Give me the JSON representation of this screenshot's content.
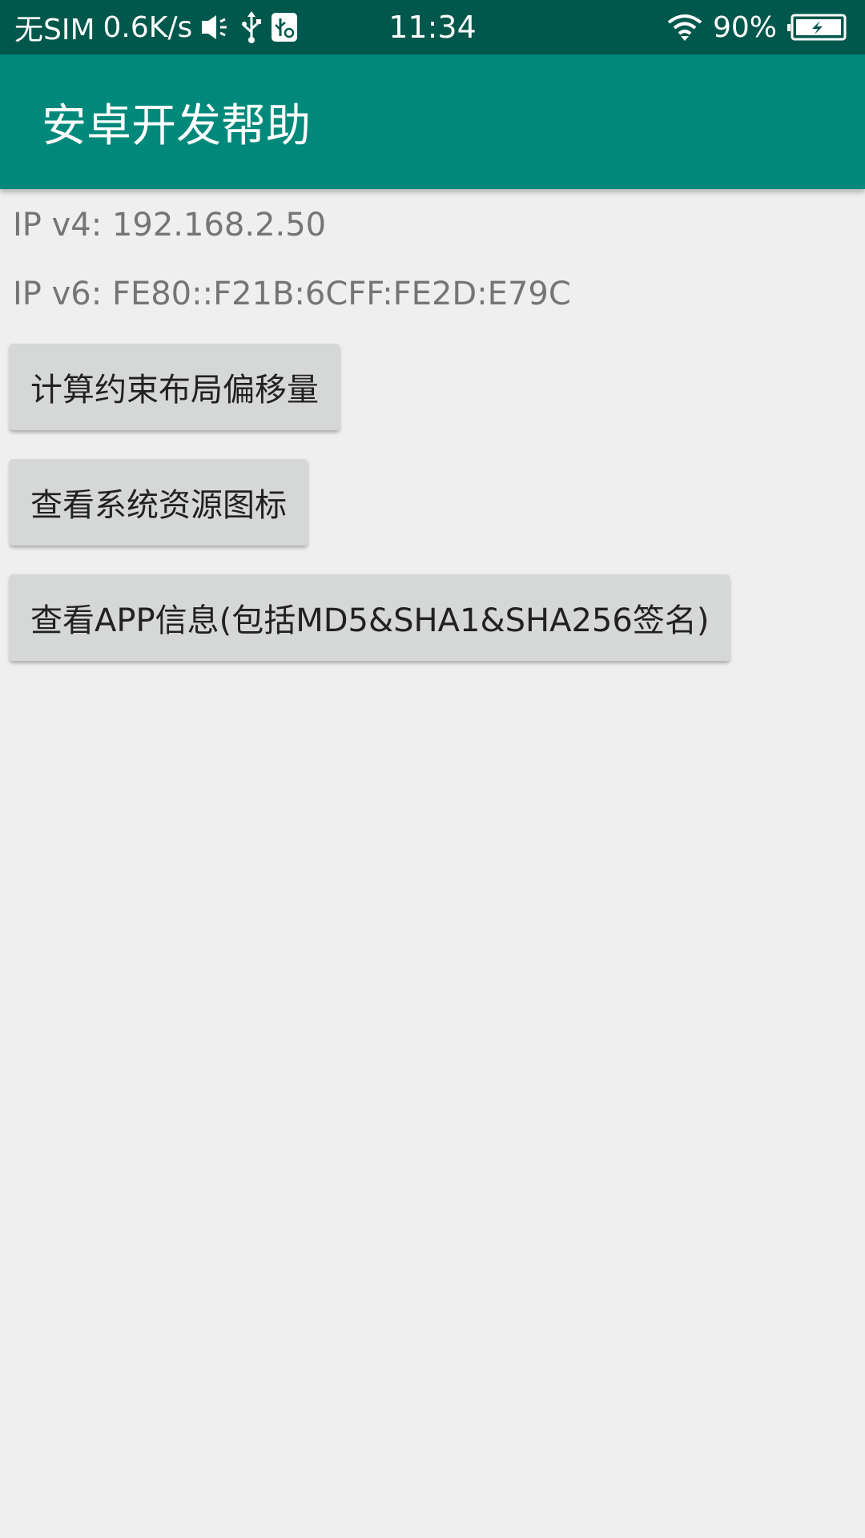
{
  "status_bar": {
    "carrier": "无SIM",
    "speed": "0.6K/s",
    "time": "11:34",
    "battery": "90%",
    "icons": [
      "vibrate-icon",
      "usb-icon",
      "usb-debug-icon",
      "wifi-icon",
      "battery-charging-icon"
    ]
  },
  "app_bar": {
    "title": "安卓开发帮助"
  },
  "main": {
    "ip_v4": "IP v4: 192.168.2.50",
    "ip_v6": "IP v6: FE80::F21B:6CFF:FE2D:E79C",
    "buttons": [
      {
        "label": "计算约束布局偏移量"
      },
      {
        "label": "查看系统资源图标"
      },
      {
        "label": "查看APP信息(包括MD5&SHA1&SHA256签名)"
      }
    ]
  },
  "colors": {
    "status_bar": "#00574b",
    "app_bar": "#00897b",
    "background": "#efefef",
    "button": "#d6d7d7"
  }
}
